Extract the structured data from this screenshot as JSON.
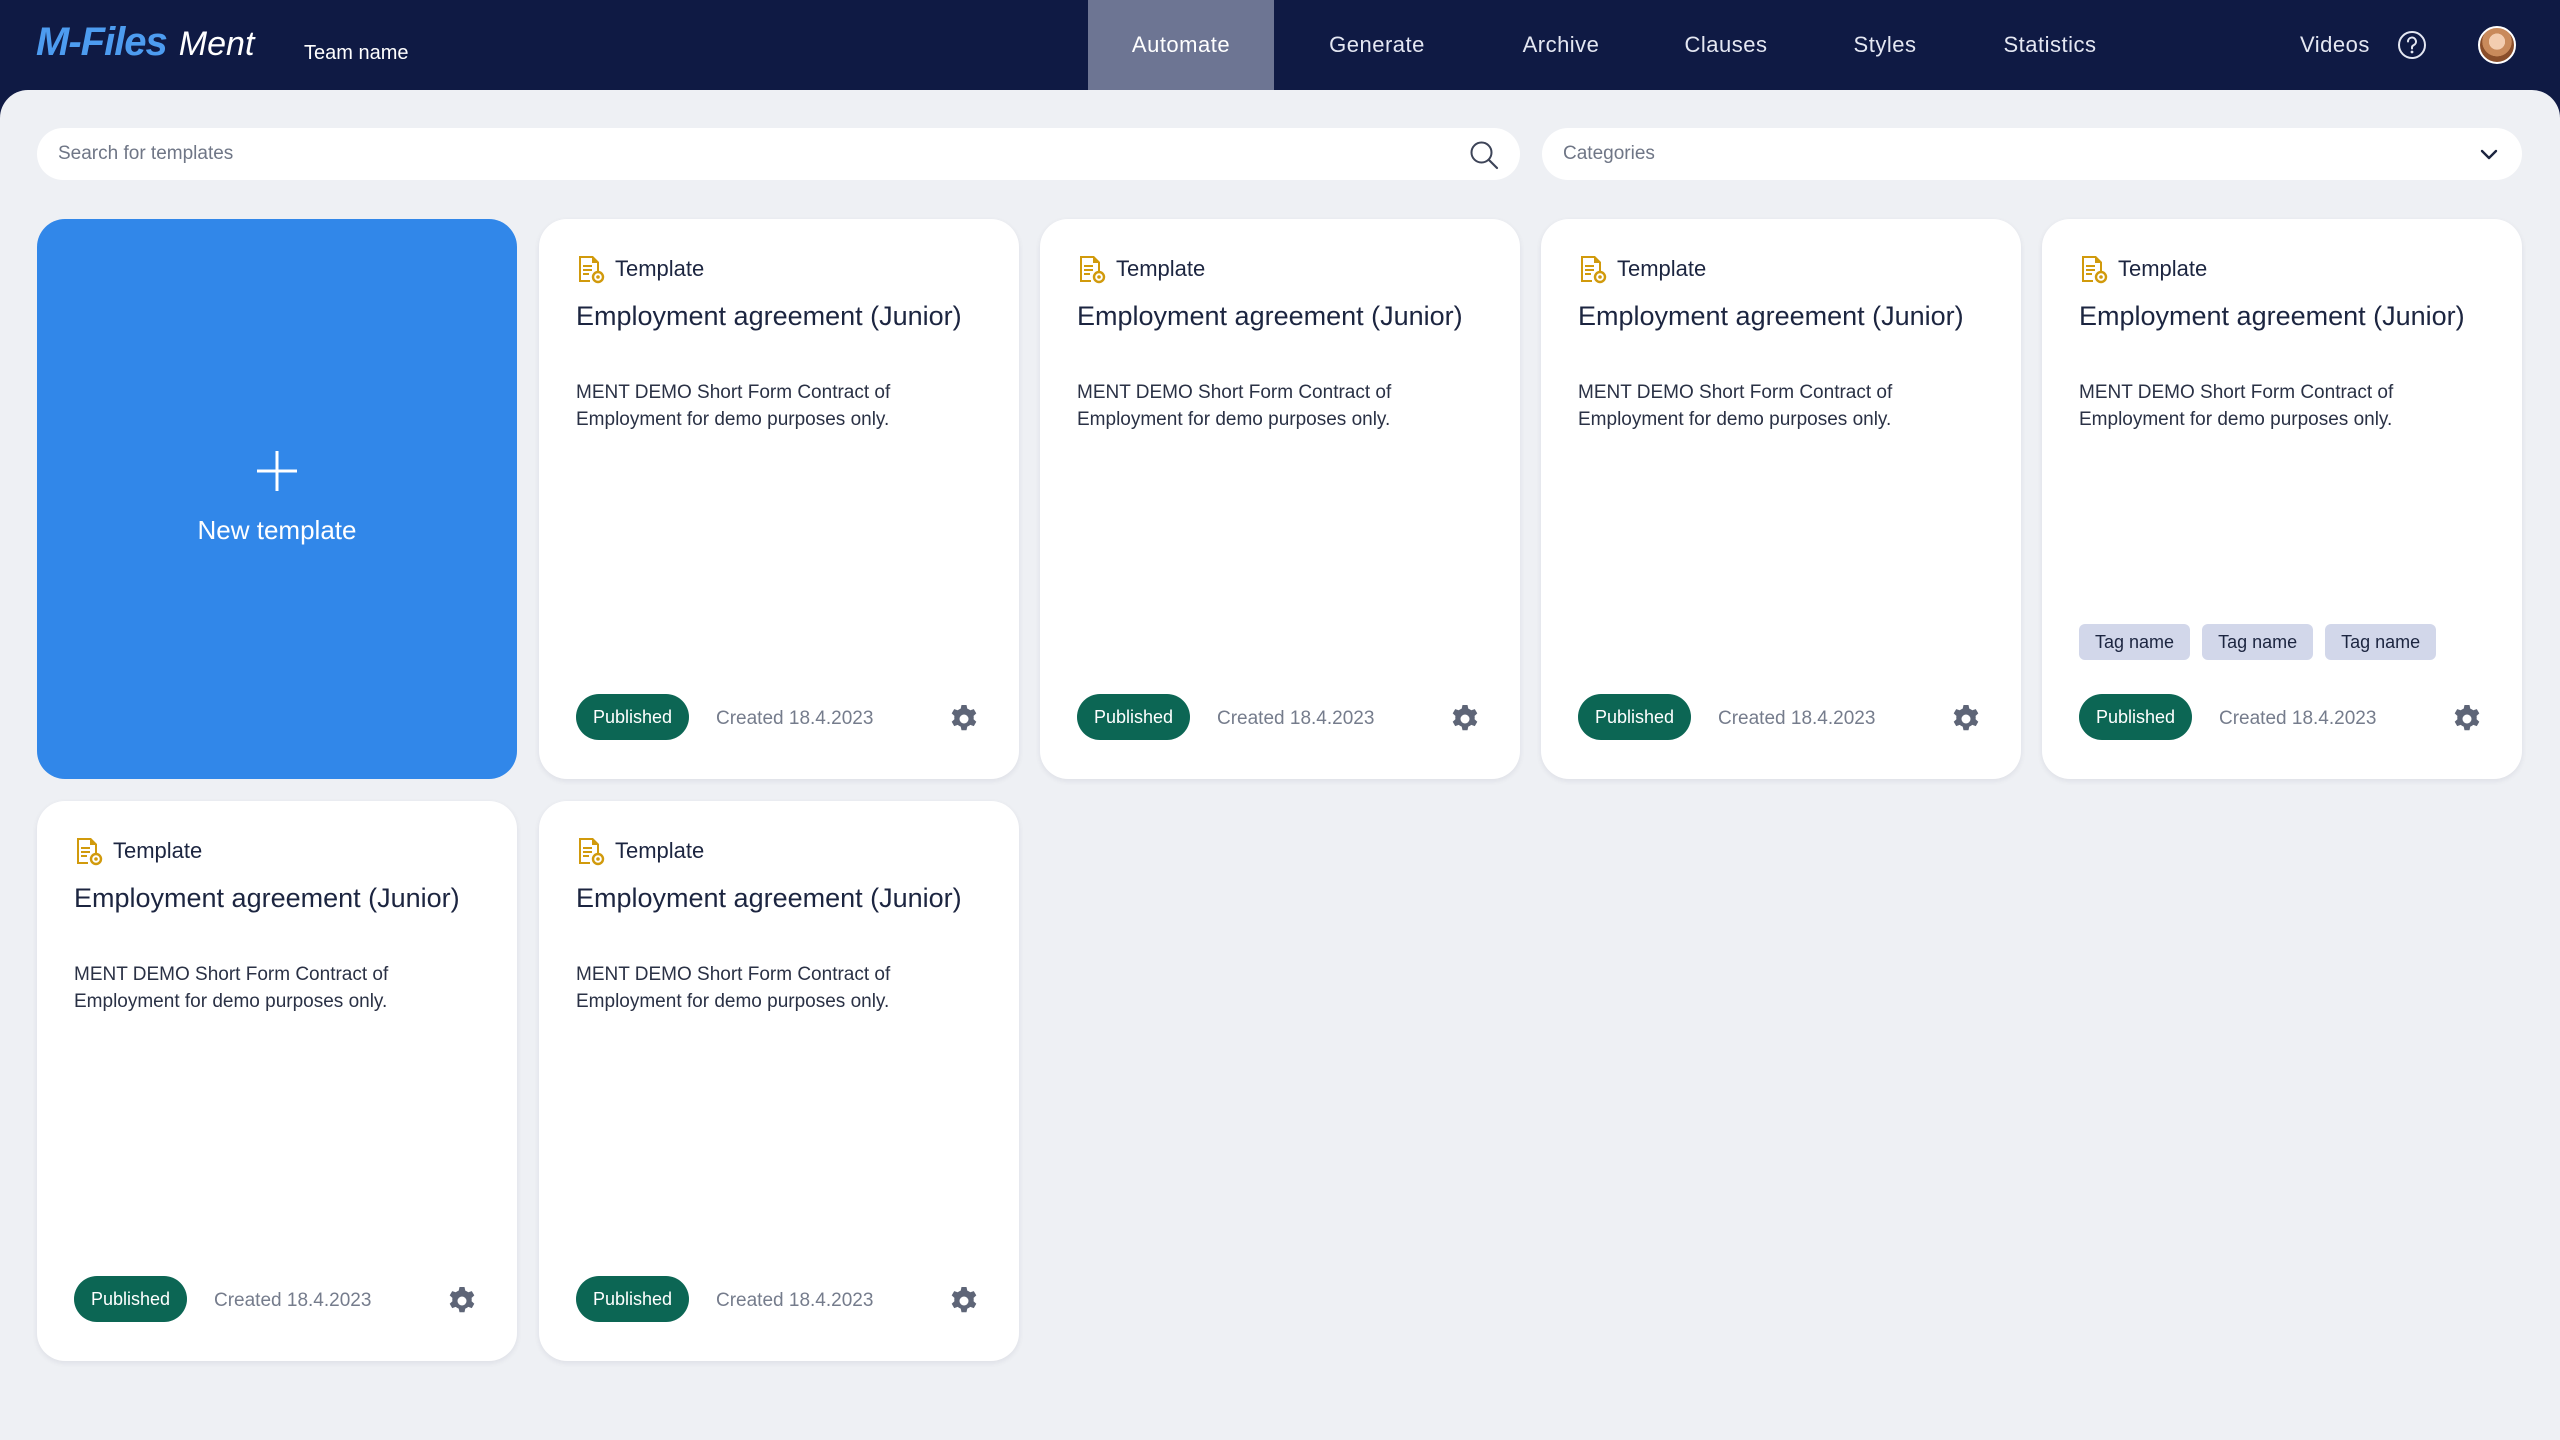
{
  "app": {
    "logo_brand": "M-Files",
    "logo_product": "Ment",
    "team_name": "Team name"
  },
  "nav": {
    "items": [
      {
        "label": "Automate",
        "active": true
      },
      {
        "label": "Generate",
        "active": false
      },
      {
        "label": "Archive",
        "active": false
      },
      {
        "label": "Clauses",
        "active": false
      },
      {
        "label": "Styles",
        "active": false
      },
      {
        "label": "Statistics",
        "active": false
      }
    ],
    "videos_label": "Videos",
    "help_icon": "question-circle-icon",
    "avatar_icon": "user-avatar"
  },
  "search": {
    "placeholder": "Search for templates",
    "icon": "search-icon"
  },
  "categories": {
    "placeholder": "Categories",
    "icon": "chevron-down-icon"
  },
  "new_template": {
    "label": "New template",
    "icon": "plus-icon"
  },
  "cards": [
    {
      "type_label": "Template",
      "title": "Employment agreement (Junior)",
      "description": "MENT DEMO Short Form Contract of Employment for demo purposes only.",
      "tags": [],
      "status": "Published",
      "created": "Created 18.4.2023"
    },
    {
      "type_label": "Template",
      "title": "Employment agreement (Junior)",
      "description": "MENT DEMO Short Form Contract of Employment for demo purposes only.",
      "tags": [],
      "status": "Published",
      "created": "Created 18.4.2023"
    },
    {
      "type_label": "Template",
      "title": "Employment agreement (Junior)",
      "description": "MENT DEMO Short Form Contract of Employment for demo purposes only.",
      "tags": [],
      "status": "Published",
      "created": "Created 18.4.2023"
    },
    {
      "type_label": "Template",
      "title": "Employment agreement (Junior)",
      "description": "MENT DEMO Short Form Contract of Employment for demo purposes only.",
      "tags": [
        "Tag name",
        "Tag name",
        "Tag name"
      ],
      "status": "Published",
      "created": "Created 18.4.2023"
    },
    {
      "type_label": "Template",
      "title": "Employment agreement (Junior)",
      "description": "MENT DEMO Short Form Contract of Employment for demo purposes only.",
      "tags": [],
      "status": "Published",
      "created": "Created 18.4.2023"
    },
    {
      "type_label": "Template",
      "title": "Employment agreement (Junior)",
      "description": "MENT DEMO Short Form Contract of Employment for demo purposes only.",
      "tags": [],
      "status": "Published",
      "created": "Created 18.4.2023"
    }
  ],
  "colors": {
    "header_bg": "#0f1a44",
    "nav_active_bg": "#6d7593",
    "content_bg": "#eef0f4",
    "new_template_bg": "#3187e9",
    "published_badge": "#0c6654",
    "template_icon": "#d19a0c",
    "tag_bg": "#d2d7ea",
    "gear_icon": "#5e6577"
  }
}
